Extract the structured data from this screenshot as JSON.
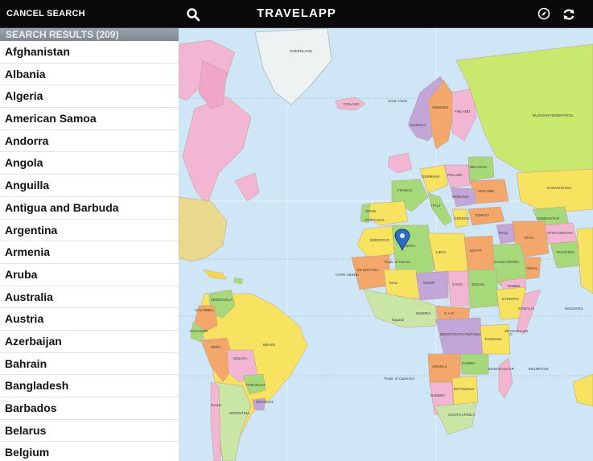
{
  "toolbar": {
    "cancel_label": "CANCEL SEARCH",
    "title": "TRAVELAPP"
  },
  "sidebar": {
    "header": "SEARCH RESULTS (209)",
    "items": [
      "Afghanistan",
      "Albania",
      "Algeria",
      "American Samoa",
      "Andorra",
      "Angola",
      "Anguilla",
      "Antigua and Barbuda",
      "Argentina",
      "Armenia",
      "Aruba",
      "Australia",
      "Austria",
      "Azerbaijan",
      "Bahrain",
      "Bangladesh",
      "Barbados",
      "Belarus",
      "Belgium"
    ]
  },
  "map": {
    "ocean_color": "#cfe6f7",
    "pin_color": "#2b6fc4",
    "labels": {
      "greenland": "GREENLAND",
      "iceland": "ICELAND",
      "arctic": "Arctic Circle",
      "sweden": "SWEDEN",
      "norway": "NORWAY",
      "finland": "FINLAND",
      "russia": "RUSSIAN FEDERATION",
      "kazakhstan": "KAZAKHSTAN",
      "uzbekistan": "UZBEKISTAN",
      "turkey": "TURKEY",
      "iran": "IRAN",
      "iraq": "IRAQ",
      "afghanistan": "AFGHANISTAN",
      "pakistan": "PAKISTAN",
      "saudi": "SAUDI ARABIA",
      "yemen": "YEMEN",
      "oman": "OMAN",
      "egypt": "EGYPT",
      "libya": "LIBYA",
      "algeria": "ALGERIA",
      "morocco": "MOROCCO",
      "mauritania": "MAURITANIA",
      "mali": "MALI",
      "niger": "NIGER",
      "chad": "CHAD",
      "sudan": "SUDAN",
      "ethiopia": "ETHIOPIA",
      "somalia": "SOMALIA",
      "nigeria": "NIGERIA",
      "car": "C.A.R.",
      "drc": "DEMOCRATIC REPUBLIC OF THE CONGO",
      "tanzania": "TANZANIA",
      "angola": "ANGOLA",
      "zambia": "ZAMBIA",
      "namibia": "NAMIBIA",
      "botswana": "BOTSWANA",
      "southafrica": "SOUTH AFRICA",
      "madagascar": "MADAGASCAR",
      "mauritius": "MAURITIUS",
      "seychelles": "SEYCHELLES",
      "maldives": "MALDIVES",
      "capeverde": "CAPE VERDE",
      "tropic_cancer": "Tropic of Cancer",
      "equator": "Equator",
      "tropic_capricorn": "Tropic of Capricorn",
      "venezuela": "VENEZUELA",
      "colombia": "COLOMBIA",
      "ecuador": "ECUADOR",
      "peru": "PERU",
      "brazil": "BRAZIL",
      "bolivia": "BOLIVIA",
      "paraguay": "PARAGUAY",
      "chile": "CHILE",
      "argentina": "ARGENTINA",
      "uruguay": "URUGUAY",
      "spain": "SPAIN",
      "france": "FRANCE",
      "portugal": "PORTUGAL",
      "germany": "GERMANY",
      "poland": "POLAND",
      "ukraine": "UKRAINE",
      "belarus": "BELARUS",
      "romania": "ROMANIA",
      "italy": "ITALY",
      "greece": "GREECE"
    }
  }
}
